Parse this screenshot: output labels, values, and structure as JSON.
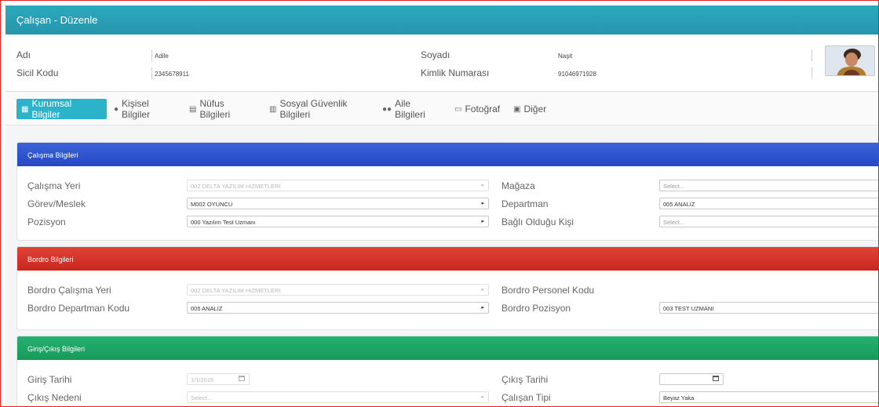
{
  "window": {
    "title": "Çalışan - Düzenle"
  },
  "summary": {
    "first_name_label": "Adı",
    "first_name": "Adile",
    "last_name_label": "Soyadı",
    "last_name": "Naşit",
    "registry_label": "Sicil Kodu",
    "registry": "2345678911",
    "id_label": "Kimlik Numarası",
    "id": "91046971928"
  },
  "tabs": [
    {
      "label": "Kurumsal Bilgiler",
      "icon": "building-icon",
      "active": true
    },
    {
      "label": "Kişisel Bilgiler",
      "icon": "user-icon",
      "active": false
    },
    {
      "label": "Nüfus Bilgileri",
      "icon": "id-card-icon",
      "active": false
    },
    {
      "label": "Sosyal Güvenlik Bilgileri",
      "icon": "building-icon",
      "active": false
    },
    {
      "label": "Aile Bilgileri",
      "icon": "users-icon",
      "active": false
    },
    {
      "label": "Fotoğraf",
      "icon": "image-icon",
      "active": false
    },
    {
      "label": "Diğer",
      "icon": "contact-icon",
      "active": false
    }
  ],
  "work": {
    "title": "Çalışma Bilgileri",
    "workplace_label": "Çalışma Yeri",
    "workplace": "002 DELTA YAZILIM HIZMETLERI",
    "job_label": "Görev/Meslek",
    "job": "M002 OYUNCU",
    "position_label": "Pozisyon",
    "position": "000 Yazılım Test Uzmanı",
    "store_label": "Mağaza",
    "store": "Select...",
    "department_label": "Departman",
    "department": "005 ANALIZ",
    "manager_label": "Bağlı Olduğu Kişi",
    "manager": "Select..."
  },
  "payroll": {
    "title": "Bordro Bilgileri",
    "workplace_label": "Bordro Çalışma Yeri",
    "workplace": "002 DELTA YAZILIM HIZMETLERI",
    "department_label": "Bordro Departman Kodu",
    "department": "005 ANALIZ",
    "personnel_code_label": "Bordro Personel Kodu",
    "position_label": "Bordro Pozisyon",
    "position": "003 TEST UZMANI"
  },
  "entry_exit": {
    "title": "Giriş/Çıkış Bilgileri",
    "entry_date_label": "Giriş Tarihi",
    "entry_date": "1/1/2015",
    "exit_date_label": "Çıkış Tarihi",
    "exit_reason_label": "Çıkış Nedeni",
    "exit_reason": "Select...",
    "employee_type_label": "Çalışan Tipi",
    "employee_type": "Beyaz Yaka"
  },
  "colors": {
    "titlebar": "#2aa9bd",
    "active_tab": "#2bb3c9",
    "work_header": "#2f56d0",
    "payroll_header": "#d6342a",
    "entry_header": "#1fa666"
  }
}
